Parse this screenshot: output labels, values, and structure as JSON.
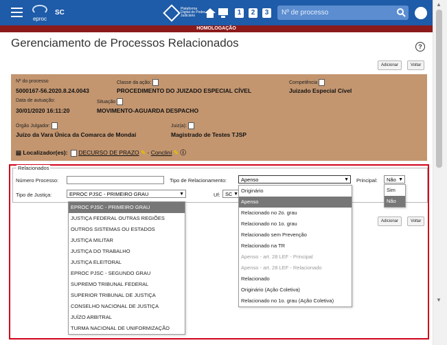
{
  "header": {
    "sigla": "SC",
    "logo_text": "eproc",
    "platform_text": "Plataforma Digital do Poder Judiciário",
    "tabs": [
      "1",
      "2",
      "3"
    ],
    "search_placeholder": "Nº de processo",
    "environment": "HOMOLOGAÇÃO"
  },
  "page": {
    "title": "Gerenciamento de Processos Relacionados",
    "help": "?",
    "add_label": "Adicionar",
    "back_label": "Voltar"
  },
  "process": {
    "numero_label": "Nº do processo",
    "numero": "5000167-56.2020.8.24.0043",
    "classe_label": "Classe da ação:",
    "classe": "PROCEDIMENTO DO JUIZADO ESPECIAL CÍVEL",
    "competencia_label": "Competência",
    "competencia": "Juizado Especial Cível",
    "data_label": "Data de autuação:",
    "data": "30/01/2020 16:11:20",
    "situacao_label": "Situação",
    "situacao": "MOVIMENTO-AGUARDA DESPACHO",
    "orgao_label": "Órgão Julgador:",
    "orgao": "Juízo da Vara Única da Comarca de Mondaí",
    "juiz_label": "Juiz(a):",
    "juiz": "Magistrado de Testes TJSP",
    "localizador_label": "Localizador(es):",
    "loc1": "DECURSO DE PRAZO",
    "loc2": "Concliní"
  },
  "form": {
    "legend": "Relacionados",
    "numero_label": "Número Processo:",
    "tipo_rel_label": "Tipo de Relacionamento:",
    "tipo_rel_value": "Apenso",
    "principal_label": "Principal:",
    "principal_value": "Não",
    "tipo_justica_label": "Tipo de Justiça:",
    "tipo_justica_value": "EPROC PJSC - PRIMEIRO GRAU",
    "uf_label": "Uf:",
    "uf_value": "SC"
  },
  "justica_options": [
    "EPROC PJSC - PRIMEIRO GRAU",
    "JUSTIÇA FEDERAL OUTRAS REGIÕES",
    "OUTROS SISTEMAS OU ESTADOS",
    "JUSTIÇA MILITAR",
    "JUSTIÇA DO TRABALHO",
    "JUSTIÇA ELEITORAL",
    "EPROC PJSC - SEGUNDO GRAU",
    "SUPREMO TRIBUNAL FEDERAL",
    "SUPERIOR TRIBUNAL DE JUSTIÇA",
    "CONSELHO NACIONAL DE JUSTIÇA",
    "JUÍZO ARBITRAL",
    "TURMA NACIONAL DE UNIFORMIZAÇÃO"
  ],
  "relacionamento_options": [
    "Originário",
    "Apenso",
    "Relacionado no 2o. grau",
    "Relacionado no 1o. grau",
    "Relacionado sem Prevenção",
    "Relacionado na TR",
    "Apenso - art. 28 LEF - Principal",
    "Apenso - art. 28 LEF - Relacionado",
    "Relacionado",
    "Originário (Ação Coletiva)",
    "Relacionado no 1o. grau (Ação Coletiva)"
  ],
  "principal_options": [
    "Sim",
    "Não"
  ],
  "colors": {
    "header": "#1e5ba8",
    "banner": "#8b1a1a",
    "info_bg": "#c39670",
    "highlight": "#d0001b"
  }
}
